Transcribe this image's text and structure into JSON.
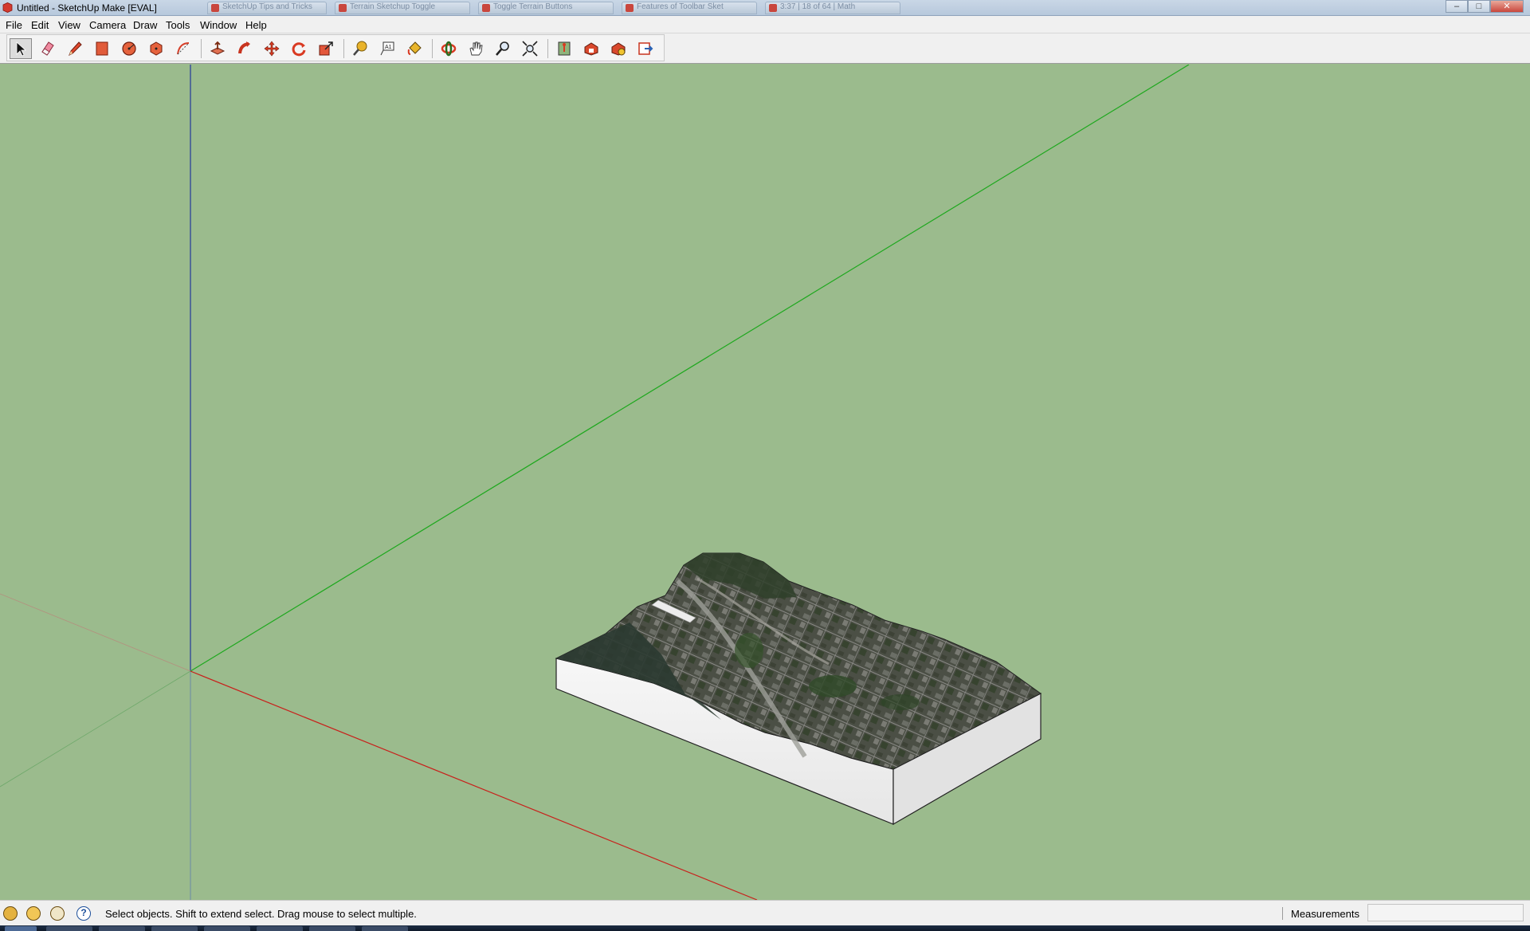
{
  "window": {
    "title": "Untitled - SketchUp Make [EVAL]",
    "background_tabs": [
      "SketchUp Tips and Tricks",
      "Terrain Sketchup Toggle",
      "Toggle Terrain Buttons",
      "Features of Toolbar Sket",
      "3:37 | 18 of 64 | Math"
    ],
    "controls": {
      "minimize": "–",
      "maximize": "□",
      "close": "✕"
    }
  },
  "menu": {
    "items": [
      "File",
      "Edit",
      "View",
      "Camera",
      "Draw",
      "Tools",
      "Window",
      "Help"
    ]
  },
  "toolbar": {
    "tools": [
      {
        "name": "select-tool",
        "icon": "arrow-cursor-icon",
        "active": true
      },
      {
        "name": "eraser-tool",
        "icon": "eraser-icon"
      },
      {
        "name": "line-tool",
        "icon": "pencil-icon"
      },
      {
        "name": "rectangle-tool",
        "icon": "rectangle-icon"
      },
      {
        "name": "circle-tool",
        "icon": "circle-icon"
      },
      {
        "name": "polygon-tool",
        "icon": "polygon-icon"
      },
      {
        "name": "arc-tool",
        "icon": "arc-icon"
      },
      {
        "name": "push-pull-tool",
        "icon": "push-pull-icon"
      },
      {
        "name": "follow-me-tool",
        "icon": "follow-me-icon"
      },
      {
        "name": "move-tool",
        "icon": "move-icon"
      },
      {
        "name": "rotate-tool",
        "icon": "rotate-icon"
      },
      {
        "name": "scale-tool",
        "icon": "scale-icon"
      },
      {
        "name": "tape-measure-tool",
        "icon": "tape-measure-icon"
      },
      {
        "name": "text-tool",
        "icon": "text-icon"
      },
      {
        "name": "paint-bucket-tool",
        "icon": "paint-bucket-icon"
      },
      {
        "name": "orbit-tool",
        "icon": "orbit-icon"
      },
      {
        "name": "pan-tool",
        "icon": "hand-icon"
      },
      {
        "name": "zoom-tool",
        "icon": "magnifier-icon"
      },
      {
        "name": "zoom-extents-tool",
        "icon": "zoom-extents-icon"
      },
      {
        "name": "add-location-tool",
        "icon": "map-pin-icon"
      },
      {
        "name": "3d-warehouse-tool",
        "icon": "warehouse-icon"
      },
      {
        "name": "extension-warehouse-tool",
        "icon": "extension-icon"
      },
      {
        "name": "send-to-layout-tool",
        "icon": "layout-icon"
      }
    ]
  },
  "status": {
    "hint": "Select objects. Shift to extend select. Drag mouse to select multiple.",
    "icons": [
      "geolocation-icon",
      "credits-icon",
      "user-icon",
      "help-icon"
    ],
    "measurements_label": "Measurements",
    "measurements_value": ""
  },
  "colors": {
    "sky": "#9bbb8d",
    "axis_red": "#c8201b",
    "axis_green": "#1ea81e",
    "axis_blue": "#23399b",
    "terrain_side": "#f2f2f2"
  }
}
